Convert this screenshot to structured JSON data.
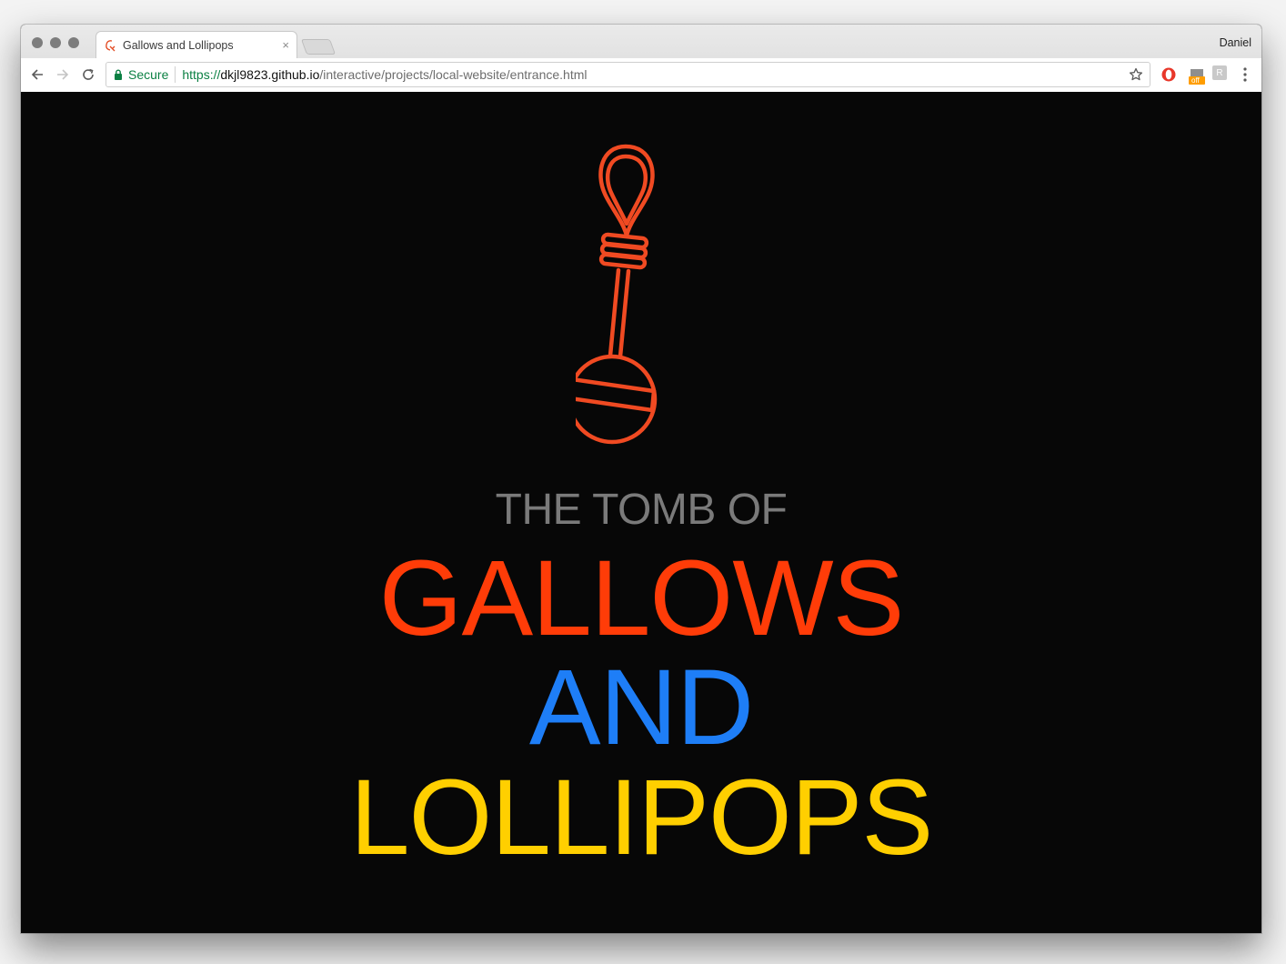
{
  "browser": {
    "tab_title": "Gallows and Lollipops",
    "tab_close": "×",
    "profile_name": "Daniel",
    "secure_label": "Secure",
    "url_scheme": "https://",
    "url_host": "dkjl9823.github.io",
    "url_path": "/interactive/projects/local-website/entrance.html",
    "extensions": [
      "opera-icon",
      "off-badge-icon",
      "extension-icon"
    ],
    "off_badge": "off",
    "ext_letter": "R"
  },
  "page": {
    "subtitle": "THE TOMB OF",
    "title_line1": "GALLOWS",
    "title_line2": "AND",
    "title_line3": "LOLLIPOPS",
    "colors": {
      "background": "#070707",
      "logo": "#f04a22",
      "subtitle": "#7a7a7a",
      "gallows": "#ff3c08",
      "and": "#1e7ef7",
      "lollipops": "#ffcf00"
    }
  }
}
